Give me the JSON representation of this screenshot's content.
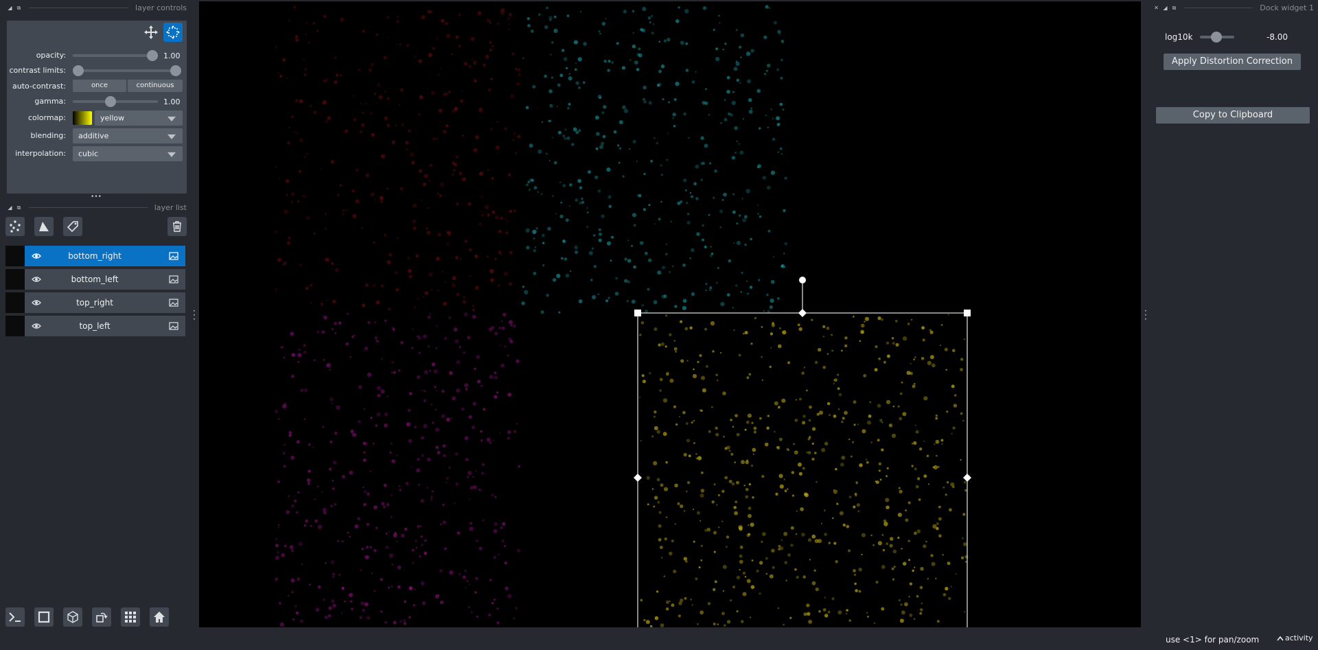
{
  "layer_controls": {
    "title": "layer controls",
    "opacity": {
      "label": "opacity:",
      "value": "1.00",
      "level": 1.0
    },
    "contrast_limits": {
      "label": "contrast limits:",
      "low": 0.0,
      "high": 1.0
    },
    "auto_contrast": {
      "label": "auto-contrast:",
      "once": "once",
      "continuous": "continuous"
    },
    "gamma": {
      "label": "gamma:",
      "value": "1.00",
      "level": 0.46
    },
    "colormap": {
      "label": "colormap:",
      "value": "yellow"
    },
    "blending": {
      "label": "blending:",
      "value": "additive"
    },
    "interpolation": {
      "label": "interpolation:",
      "value": "cubic"
    },
    "more_dots": "•••"
  },
  "layer_list": {
    "title": "layer list",
    "layers": [
      {
        "name": "bottom_right",
        "selected": true
      },
      {
        "name": "bottom_left",
        "selected": false
      },
      {
        "name": "top_right",
        "selected": false
      },
      {
        "name": "top_left",
        "selected": false
      }
    ]
  },
  "dock_widget": {
    "title": "Dock widget 1",
    "slider_label": "log10k",
    "slider_value": "-8.00",
    "slider_level": 0.5,
    "apply_button": "Apply Distortion Correction",
    "copy_button": "Copy to Clipboard"
  },
  "status_bar": {
    "hint": "use <1> for pan/zoom",
    "activity": "activity"
  },
  "colors": {
    "accent": "#0a72c4",
    "background": "#262930",
    "panel": "#414851",
    "quadrant_top_left": "#c0141a",
    "quadrant_top_right": "#1fb5bd",
    "quadrant_bottom_left": "#b5139f",
    "quadrant_bottom_right": "#c9b316"
  }
}
